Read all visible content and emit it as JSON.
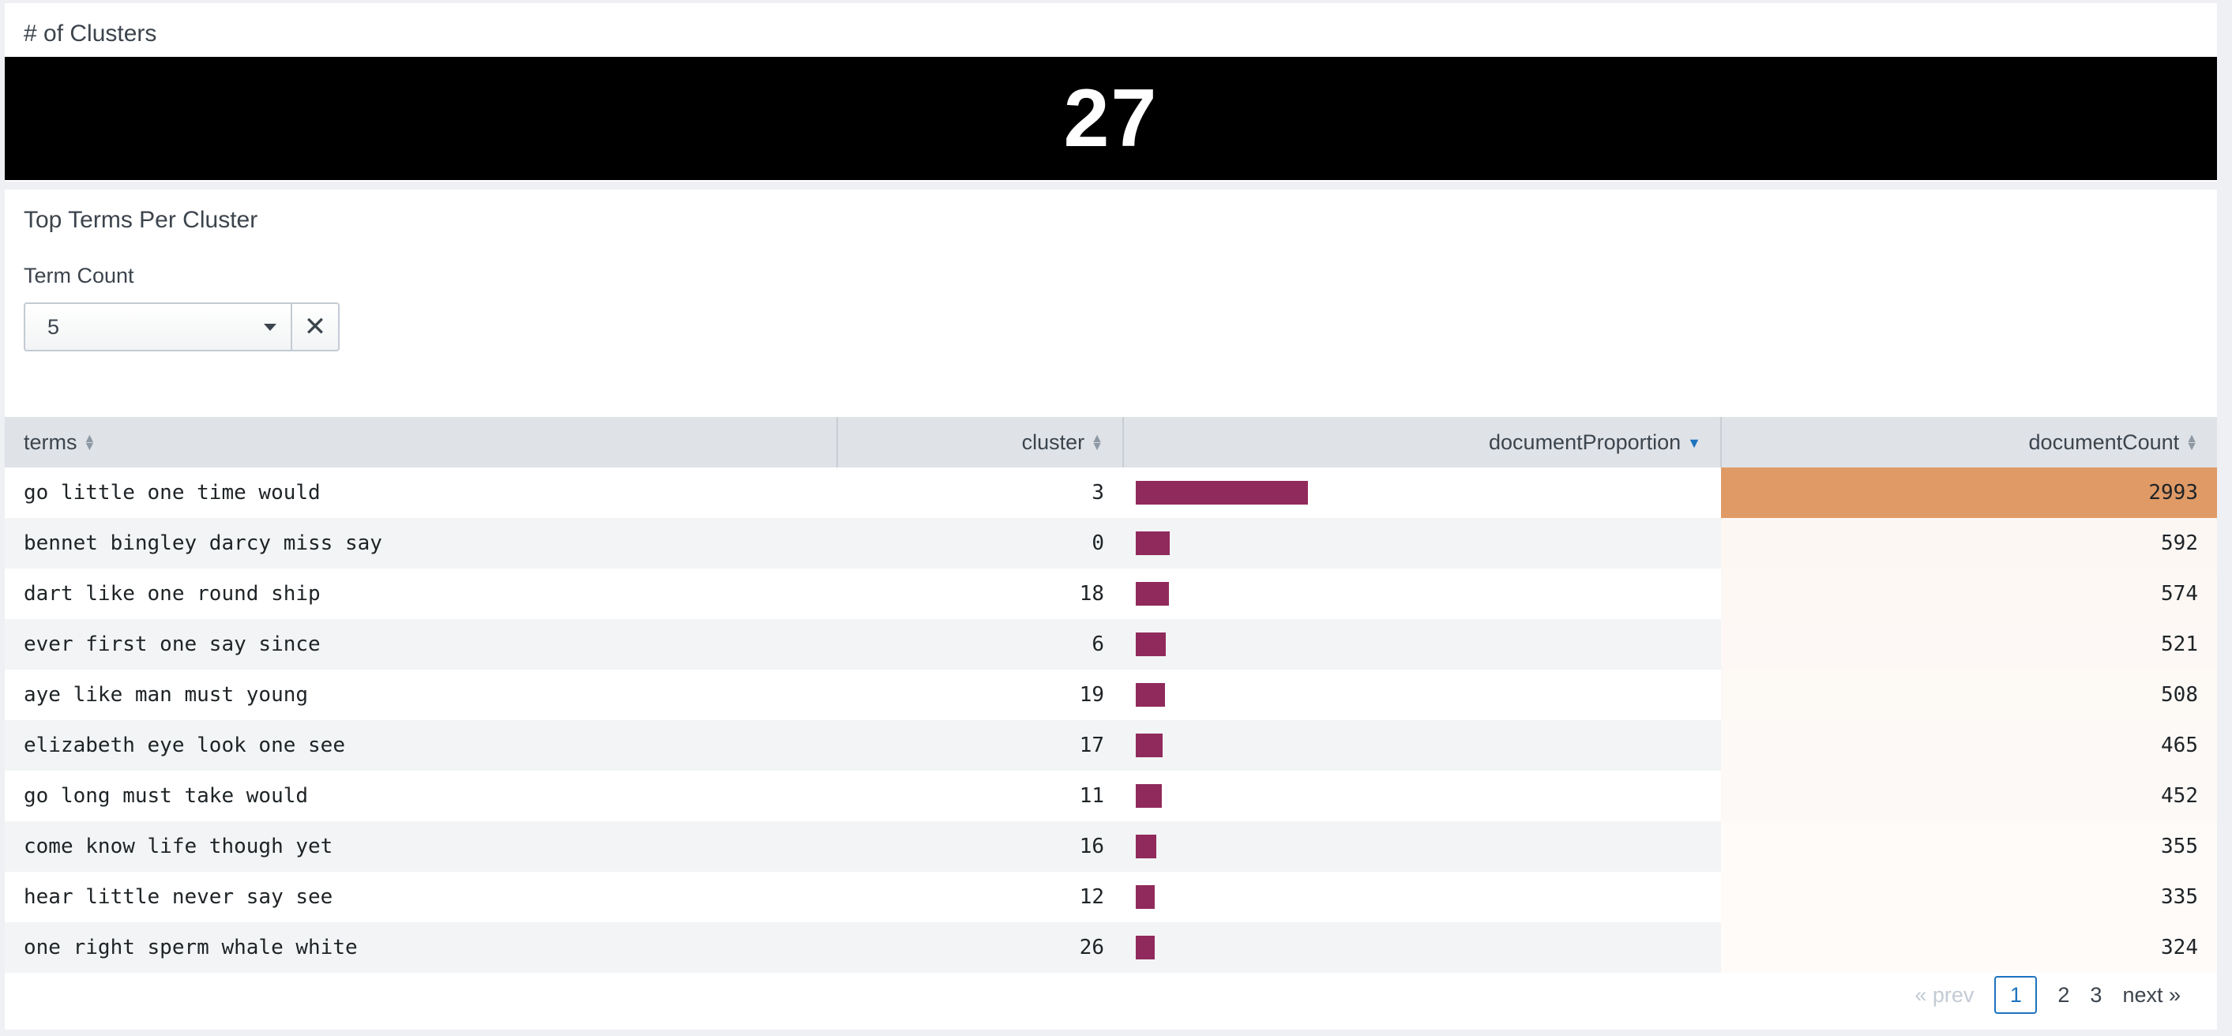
{
  "clusters_panel": {
    "title": "# of Clusters",
    "value": "27"
  },
  "terms_panel": {
    "title": "Top Terms Per Cluster",
    "input_label": "Term Count",
    "dropdown_value": "5",
    "clear_glyph": "✕"
  },
  "table": {
    "columns": [
      "terms",
      "cluster",
      "documentProportion",
      "documentCount"
    ],
    "sorted_column": "documentProportion",
    "bar_color": "#912a5c",
    "heat_color": "#e09a66",
    "rows": [
      {
        "terms": "go little one time would",
        "cluster": "3",
        "proportion": 0.2176,
        "count": "2993"
      },
      {
        "terms": "bennet bingley darcy miss say",
        "cluster": "0",
        "proportion": 0.043,
        "count": "592"
      },
      {
        "terms": "dart like one round ship",
        "cluster": "18",
        "proportion": 0.0417,
        "count": "574"
      },
      {
        "terms": "ever first one say since",
        "cluster": "6",
        "proportion": 0.0379,
        "count": "521"
      },
      {
        "terms": "aye like man must young",
        "cluster": "19",
        "proportion": 0.0369,
        "count": "508"
      },
      {
        "terms": "elizabeth eye look one see",
        "cluster": "17",
        "proportion": 0.0338,
        "count": "465"
      },
      {
        "terms": "go long must take would",
        "cluster": "11",
        "proportion": 0.0329,
        "count": "452"
      },
      {
        "terms": "come know life though yet",
        "cluster": "16",
        "proportion": 0.0258,
        "count": "355"
      },
      {
        "terms": "hear little never say see",
        "cluster": "12",
        "proportion": 0.0244,
        "count": "335"
      },
      {
        "terms": "one right sperm whale white",
        "cluster": "26",
        "proportion": 0.0236,
        "count": "324"
      }
    ]
  },
  "pagination": {
    "prev": "« prev",
    "pages": [
      "1",
      "2",
      "3"
    ],
    "current": "1",
    "next": "next »"
  }
}
